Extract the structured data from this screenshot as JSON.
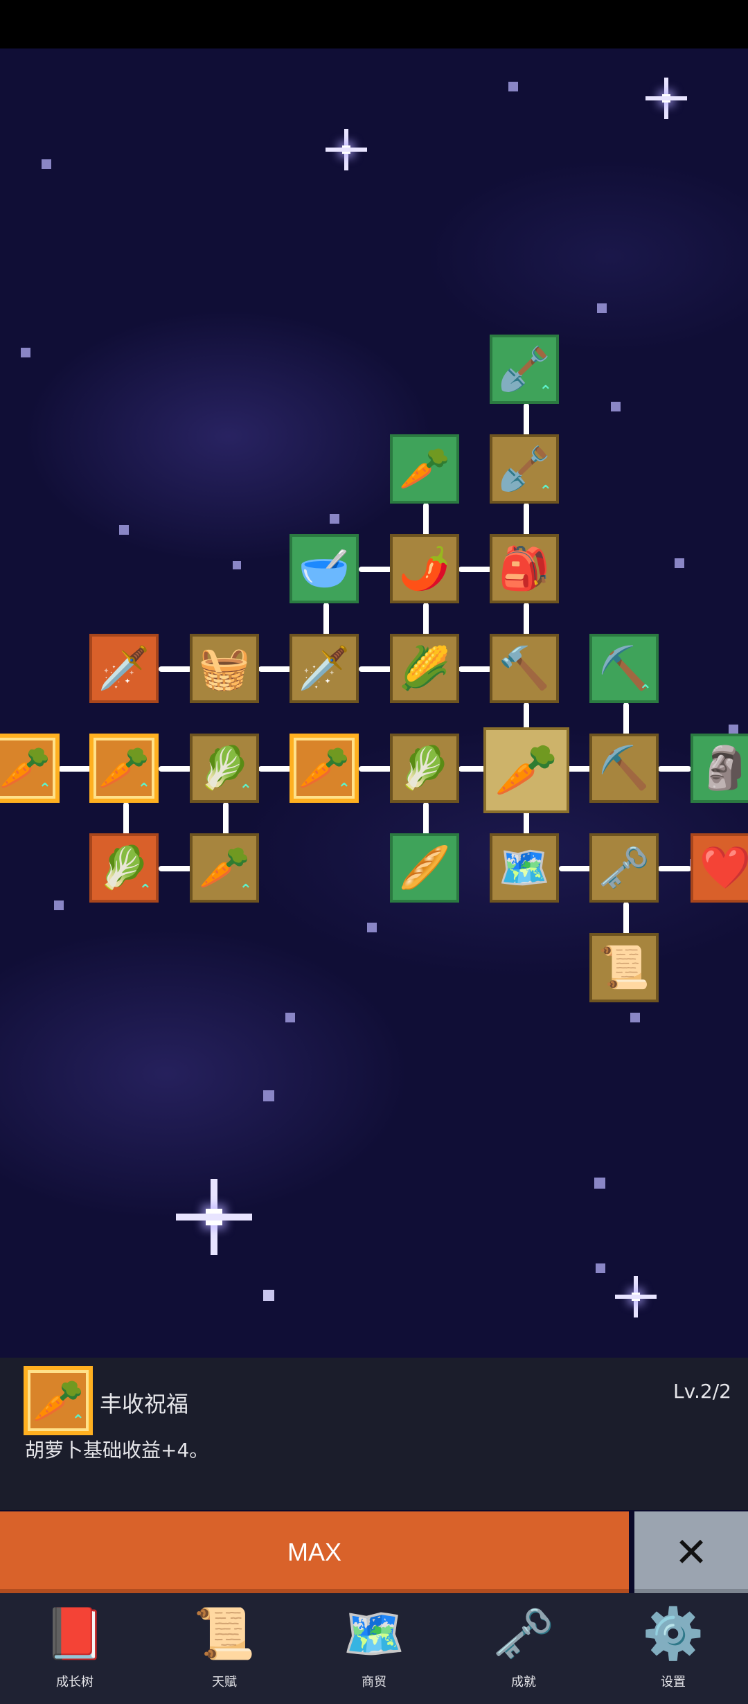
{
  "skill_tree": {
    "nodes": [
      {
        "id": "shovel-top",
        "icon": "shovel-icon",
        "glyph": "🪏",
        "color": "green",
        "up": true
      },
      {
        "id": "shovel-2",
        "icon": "shovel-icon",
        "glyph": "🪏",
        "color": "brown",
        "up": true
      },
      {
        "id": "radish",
        "icon": "radish-icon",
        "glyph": "🥕",
        "color": "green",
        "up": false
      },
      {
        "id": "bowl",
        "icon": "bowl-icon",
        "glyph": "🥣",
        "color": "green",
        "up": false
      },
      {
        "id": "chili",
        "icon": "chili-icon",
        "glyph": "🌶️",
        "color": "brown",
        "up": false
      },
      {
        "id": "sack",
        "icon": "sack-icon",
        "glyph": "🎒",
        "color": "brown",
        "up": false
      },
      {
        "id": "sword-red",
        "icon": "sword-icon",
        "glyph": "🗡️",
        "color": "orange",
        "up": false
      },
      {
        "id": "basket",
        "icon": "basket-icon",
        "glyph": "🧺",
        "color": "brown",
        "up": false
      },
      {
        "id": "sword",
        "icon": "sword-icon",
        "glyph": "🗡️",
        "color": "brown",
        "up": false
      },
      {
        "id": "corn",
        "icon": "corn-icon",
        "glyph": "🌽",
        "color": "brown",
        "up": false
      },
      {
        "id": "hoe",
        "icon": "hoe-icon",
        "glyph": "🔨",
        "color": "brown",
        "up": false
      },
      {
        "id": "pickaxe-green",
        "icon": "pickaxe-icon",
        "glyph": "⛏️",
        "color": "green",
        "up": true
      },
      {
        "id": "carrot-edge",
        "icon": "carrot-icon",
        "glyph": "🥕",
        "color": "gold",
        "up": true
      },
      {
        "id": "carrot-2",
        "icon": "carrot-icon",
        "glyph": "🥕",
        "color": "gold",
        "up": true
      },
      {
        "id": "cabbage-1",
        "icon": "cabbage-icon",
        "glyph": "🥬",
        "color": "brown",
        "up": true
      },
      {
        "id": "carrot-3",
        "icon": "carrot-icon",
        "glyph": "🥕",
        "color": "gold",
        "up": true
      },
      {
        "id": "cabbage-2",
        "icon": "cabbage-icon",
        "glyph": "🥬",
        "color": "brown",
        "up": false
      },
      {
        "id": "carrot-center",
        "icon": "carrot-icon",
        "glyph": "🥕",
        "color": "selected",
        "up": false
      },
      {
        "id": "pickaxe",
        "icon": "pickaxe-icon",
        "glyph": "⛏️",
        "color": "brown",
        "up": false
      },
      {
        "id": "statue",
        "icon": "statue-icon",
        "glyph": "🗿",
        "color": "green",
        "up": false
      },
      {
        "id": "cabbage-red",
        "icon": "cabbage-icon",
        "glyph": "🥬",
        "color": "orange",
        "up": true
      },
      {
        "id": "carrot-low",
        "icon": "carrot-icon",
        "glyph": "🥕",
        "color": "brown",
        "up": true
      },
      {
        "id": "parsnip",
        "icon": "parsnip-icon",
        "glyph": "🥖",
        "color": "green",
        "up": false
      },
      {
        "id": "map",
        "icon": "map-icon",
        "glyph": "🗺️",
        "color": "brown",
        "up": false
      },
      {
        "id": "key",
        "icon": "key-icon",
        "glyph": "🗝️",
        "color": "brown",
        "up": false
      },
      {
        "id": "heart",
        "icon": "heart-icon",
        "glyph": "❤️",
        "color": "orange",
        "up": false
      },
      {
        "id": "scroll",
        "icon": "scroll-icon",
        "glyph": "📜",
        "color": "brown",
        "up": false
      }
    ]
  },
  "info": {
    "icon": "carrot-icon",
    "glyph": "🥕",
    "title": "丰收祝福",
    "level": "Lv.2/2",
    "description": "胡萝卜基础收益+4。"
  },
  "actions": {
    "max_label": "MAX",
    "close_icon": "close-icon",
    "close_glyph": "✕"
  },
  "nav": {
    "items": [
      {
        "label": "成长树",
        "icon": "book-icon",
        "glyph": "📕"
      },
      {
        "label": "天赋",
        "icon": "scroll-icon",
        "glyph": "📜"
      },
      {
        "label": "商贸",
        "icon": "map-icon",
        "glyph": "🗺️"
      },
      {
        "label": "成就",
        "icon": "key-icon",
        "glyph": "🗝️"
      },
      {
        "label": "设置",
        "icon": "gear-icon",
        "glyph": "⚙️"
      }
    ]
  },
  "colors": {
    "background": "#100e36",
    "node_brown": "#a7853e",
    "node_green": "#3fa35a",
    "node_orange": "#d9602a",
    "max_button": "#d9622a",
    "close_button": "#9ba4b0",
    "panel": "#1b1d2b",
    "nav": "#1f2233"
  }
}
